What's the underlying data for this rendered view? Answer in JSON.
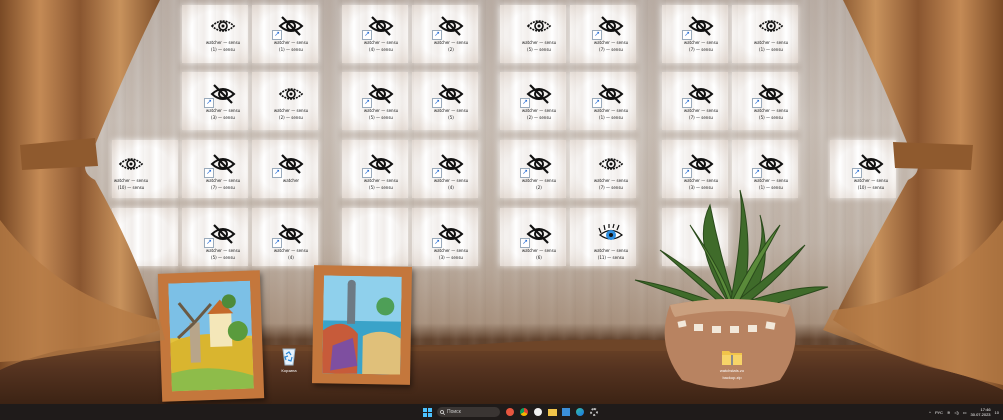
{
  "desktop": {
    "icons": [
      {
        "glyph": "eye-open-icon",
        "line1": "watcher — sensu",
        "line2": "(1) — sensu",
        "shortcut": false
      },
      {
        "glyph": "eye-slash-icon",
        "line1": "watcher — sensu",
        "line2": "(1) — sensu",
        "shortcut": true
      },
      {
        "glyph": "eye-slash-icon",
        "line1": "watcher — sensu",
        "line2": "(4) — sensu",
        "shortcut": true
      },
      {
        "glyph": "eye-slash-icon",
        "line1": "watcher — sensu",
        "line2": "(2)",
        "shortcut": true
      },
      {
        "glyph": "eye-open-icon",
        "line1": "watcher — sensu",
        "line2": "(5) — sensu",
        "shortcut": false
      },
      {
        "glyph": "eye-slash-icon",
        "line1": "watcher — sensu",
        "line2": "(7) — sensu",
        "shortcut": true
      },
      {
        "glyph": "eye-slash-icon",
        "line1": "watcher — sensu",
        "line2": "(7) — sensu",
        "shortcut": true
      },
      {
        "glyph": "eye-open-icon",
        "line1": "watcher — sensu",
        "line2": "(1) — sensu",
        "shortcut": false
      },
      {
        "glyph": "eye-slash-icon",
        "line1": "watcher — sensu",
        "line2": "(3) — sensu",
        "shortcut": true
      },
      {
        "glyph": "eye-open-icon",
        "line1": "watcher — sensu",
        "line2": "(2) — sensu",
        "shortcut": false
      },
      {
        "glyph": "eye-slash-icon",
        "line1": "watcher — sensu",
        "line2": "(5) — sensu",
        "shortcut": true
      },
      {
        "glyph": "eye-slash-icon",
        "line1": "watcher — sensu",
        "line2": "(5)",
        "shortcut": true
      },
      {
        "glyph": "eye-slash-icon",
        "line1": "watcher — sensu",
        "line2": "(2) — sensu",
        "shortcut": true
      },
      {
        "glyph": "eye-slash-icon",
        "line1": "watcher — sensu",
        "line2": "(1) — sensu",
        "shortcut": true
      },
      {
        "glyph": "eye-slash-icon",
        "line1": "watcher — sensu",
        "line2": "(7) — sensu",
        "shortcut": true
      },
      {
        "glyph": "eye-slash-icon",
        "line1": "watcher — sensu",
        "line2": "(5) — sensu",
        "shortcut": true
      },
      {
        "glyph": "eye-open-icon",
        "line1": "watcher — sensu",
        "line2": "(10) — sensu",
        "shortcut": false
      },
      {
        "glyph": "eye-slash-icon",
        "line1": "watcher — sensu",
        "line2": "(7) — sensu",
        "shortcut": true
      },
      {
        "glyph": "eye-slash-icon",
        "line1": "watcher",
        "line2": "",
        "shortcut": true
      },
      {
        "glyph": "eye-slash-icon",
        "line1": "watcher — sensu",
        "line2": "(5) — sensu",
        "shortcut": true
      },
      {
        "glyph": "eye-slash-icon",
        "line1": "watcher — sensu",
        "line2": "(4)",
        "shortcut": true
      },
      {
        "glyph": "eye-slash-icon",
        "line1": "watcher — sensu",
        "line2": "(2)",
        "shortcut": true
      },
      {
        "glyph": "eye-open-icon",
        "line1": "watcher — sensu",
        "line2": "(7) — sensu",
        "shortcut": false
      },
      {
        "glyph": "eye-slash-icon",
        "line1": "watcher — sensu",
        "line2": "(3) — sensu",
        "shortcut": true
      },
      {
        "glyph": "eye-slash-icon",
        "line1": "watcher — sensu",
        "line2": "(1) — sensu",
        "shortcut": true
      },
      {
        "glyph": "eye-slash-icon",
        "line1": "watcher — sensu",
        "line2": "(10) — sensu",
        "shortcut": true
      },
      {
        "glyph": "eye-slash-icon",
        "line1": "watcher — sensu",
        "line2": "(5) — sensu",
        "shortcut": true
      },
      {
        "glyph": "eye-slash-icon",
        "line1": "watcher — sensu",
        "line2": "(4)",
        "shortcut": true
      },
      {
        "glyph": "eye-slash-icon",
        "line1": "watcher — sensu",
        "line2": "(3) — sensu",
        "shortcut": true
      },
      {
        "glyph": "eye-slash-icon",
        "line1": "watcher — sensu",
        "line2": "(6)",
        "shortcut": true
      },
      {
        "glyph": "eye-lashes-icon",
        "line1": "watcher — sensu",
        "line2": "(11) — sensu",
        "shortcut": false
      }
    ],
    "recycle_bin": {
      "label": "Корзина",
      "icon": "recycle-bin-icon"
    },
    "folder": {
      "line1": "watchstats.zo",
      "line2": "backup.zip",
      "icon": "folder-icon"
    }
  },
  "taskbar": {
    "search_placeholder": "Поиск",
    "apps": [
      "start-icon",
      "search-icon",
      "browser-icon",
      "chrome-icon",
      "info-icon",
      "files-icon",
      "store-icon",
      "edge-icon",
      "settings-icon"
    ],
    "tray": {
      "lang": "РУС",
      "time": "17:46",
      "date": "30.07.2023",
      "notification": "10"
    }
  },
  "colors": {
    "frame": "#c4773c",
    "taskbar": "#1f1b1a",
    "shelf": "#553320",
    "curtain": "#a8703f"
  }
}
